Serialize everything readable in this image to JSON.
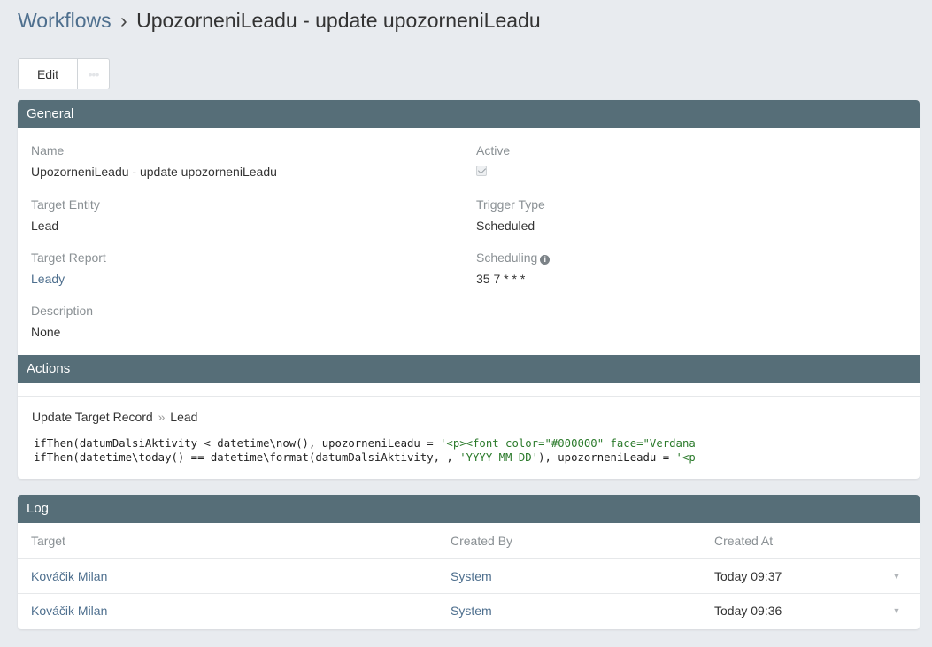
{
  "header": {
    "breadcrumb": "Workflows",
    "separator": "›",
    "title": "UpozorneniLeadu - update upozorneniLeadu"
  },
  "toolbar": {
    "edit_label": "Edit",
    "more_label": "•••"
  },
  "general": {
    "heading": "General",
    "name_label": "Name",
    "name_value": "UpozorneniLeadu - update upozorneniLeadu",
    "active_label": "Active",
    "active_checked": true,
    "target_entity_label": "Target Entity",
    "target_entity_value": "Lead",
    "trigger_type_label": "Trigger Type",
    "trigger_type_value": "Scheduled",
    "target_report_label": "Target Report",
    "target_report_value": "Leady",
    "scheduling_label": "Scheduling",
    "scheduling_value": "35 7 * * *",
    "description_label": "Description",
    "description_value": "None"
  },
  "actions": {
    "heading": "Actions",
    "action_title": "Update Target Record",
    "action_arrow": "»",
    "action_target": "Lead",
    "code_line1_a": "ifThen(datumDalsiAktivity < datetime\\now(), upozorneniLeadu = ",
    "code_line1_b": "'<p><font color=\"#000000\" face=\"Verdana",
    "code_line2_a": "ifThen(datetime\\today() == datetime\\format(datumDalsiAktivity, , ",
    "code_line2_b": "'YYYY-MM-DD'",
    "code_line2_c": "), upozorneniLeadu = ",
    "code_line2_d": "'<p"
  },
  "log": {
    "heading": "Log",
    "columns": [
      "Target",
      "Created By",
      "Created At"
    ],
    "rows": [
      {
        "target": "Kováčik Milan",
        "created_by": "System",
        "created_at": "Today 09:37"
      },
      {
        "target": "Kováčik Milan",
        "created_by": "System",
        "created_at": "Today 09:36"
      }
    ]
  },
  "icons": {
    "info": "info-circle-icon",
    "dropdown": "caret-down-icon"
  },
  "colors": {
    "panel_header": "#566e78",
    "link": "#4e6f8e",
    "background": "#e8ebef"
  }
}
